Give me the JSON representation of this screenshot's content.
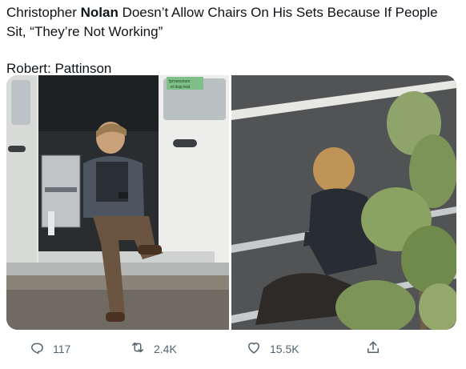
{
  "tweet": {
    "text_before_bold": "Christopher ",
    "bold": "Nolan",
    "text_after_bold": " Doesn’t Allow Chairs On His Sets Because If People Sit, “They’re Not Working”",
    "caption": "Robert: Pattinson"
  },
  "media": {
    "left_photo": {
      "sign_line1": "fprnesorium",
      "sign_line2": "ei doja leat"
    }
  },
  "actions": {
    "reply_count": "117",
    "retweet_count": "2.4K",
    "like_count": "15.5K"
  },
  "icons": [
    "reply-icon",
    "retweet-icon",
    "like-icon",
    "share-icon"
  ],
  "colors": {
    "icon_gray": "#536471",
    "text": "#0f1419"
  }
}
